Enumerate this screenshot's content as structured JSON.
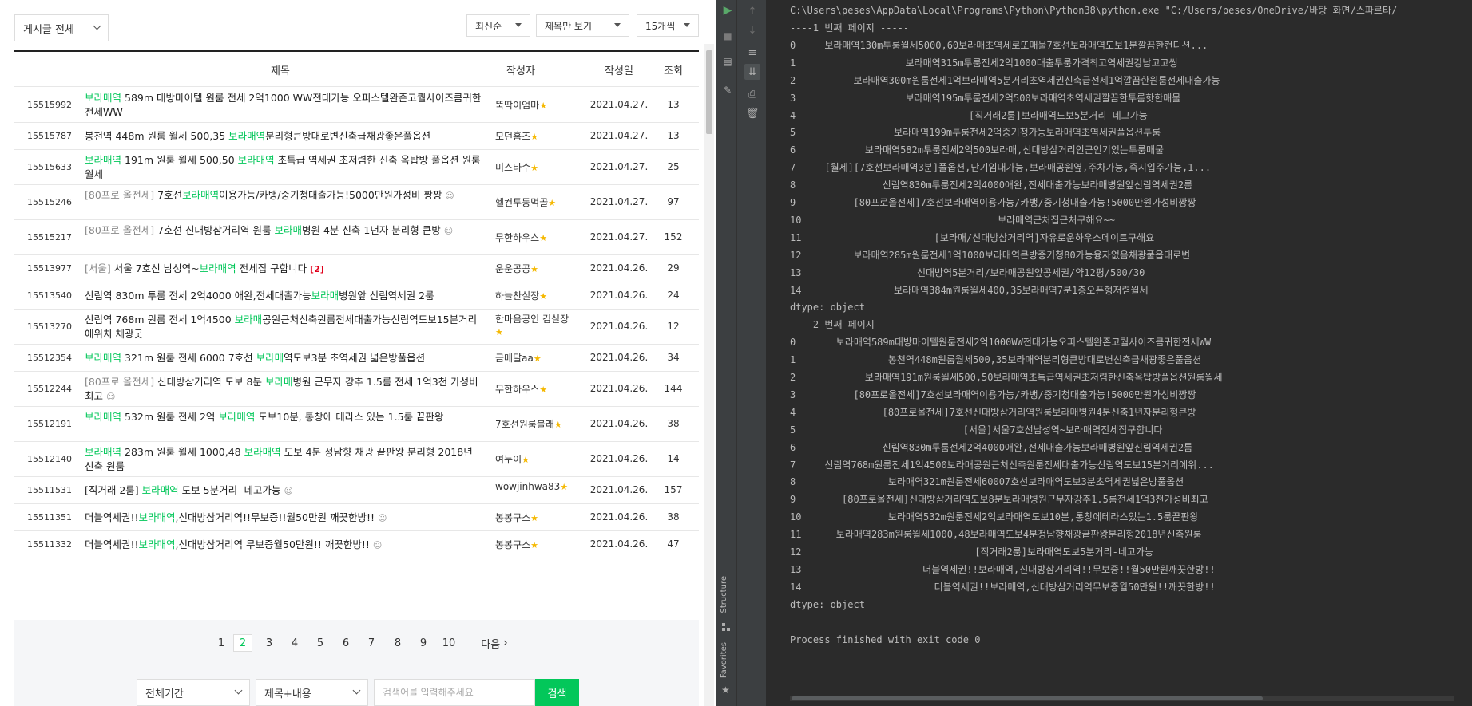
{
  "board": {
    "filters": {
      "category": "게시글 전체",
      "sort": "최신순",
      "view": "제목만 보기",
      "per_page": "15개씩"
    },
    "headers": {
      "title": "제목",
      "author": "작성자",
      "date": "작성일",
      "views": "조회"
    },
    "rows": [
      {
        "no": "15515992",
        "title": [
          {
            "t": "보라매역",
            "c": "hl"
          },
          {
            "t": " 589m 대방마이텔 원룸 전세 2억1000 WW전대가능 오피스텔완존고퀄사이즈큼귀한전세WW",
            "c": ""
          }
        ],
        "author": "뚝딱이엄마",
        "star": true,
        "date": "2021.04.27.",
        "views": "13"
      },
      {
        "no": "15515787",
        "title": [
          {
            "t": "봉천역 448m 원룸 월세 500,35 ",
            "c": ""
          },
          {
            "t": "보라매역",
            "c": "hl"
          },
          {
            "t": "분리형큰방대로변신축급채광좋은풀옵션",
            "c": ""
          }
        ],
        "author": "모던홈즈",
        "star": true,
        "date": "2021.04.27.",
        "views": "13"
      },
      {
        "no": "15515633",
        "title": [
          {
            "t": "보라매역",
            "c": "hl"
          },
          {
            "t": " 191m 원룸 월세 500,50 ",
            "c": ""
          },
          {
            "t": "보라매역",
            "c": "hl"
          },
          {
            "t": " 초특급 역세권 초저렴한 신축 옥탑방 풀옵션 원룸 월세",
            "c": ""
          }
        ],
        "author": "미스타수",
        "star": true,
        "date": "2021.04.27.",
        "views": "25"
      },
      {
        "no": "15515246",
        "title": [
          {
            "t": "[80프로 올전세] ",
            "c": "pre"
          },
          {
            "t": "7호선",
            "c": ""
          },
          {
            "t": "보라매역",
            "c": "hl"
          },
          {
            "t": "이용가능/카뱅/중기청대출가능!5000만원가성비 짱짱 ",
            "c": ""
          },
          {
            "t": "☺",
            "c": "emo"
          }
        ],
        "author": "헬컨투동먹골",
        "star": true,
        "date": "2021.04.27.",
        "views": "97"
      },
      {
        "no": "15515217",
        "title": [
          {
            "t": "[80프로 올전세] ",
            "c": "pre"
          },
          {
            "t": "7호선 신대방삼거리역 원룸 ",
            "c": ""
          },
          {
            "t": "보라매",
            "c": "hl"
          },
          {
            "t": "병원 4분 신축 1년자 분리형 큰방 ",
            "c": ""
          },
          {
            "t": "☺",
            "c": "emo"
          }
        ],
        "author": "무한하우스",
        "star": true,
        "date": "2021.04.27.",
        "views": "152"
      },
      {
        "no": "15513977",
        "title": [
          {
            "t": "[서울] ",
            "c": "pre"
          },
          {
            "t": "서울 7호선 남성역~",
            "c": ""
          },
          {
            "t": "보라매역",
            "c": "hl"
          },
          {
            "t": " 전세집 구합니다 ",
            "c": ""
          },
          {
            "t": "[2]",
            "c": "cnt"
          }
        ],
        "author": "운운공공",
        "star": true,
        "date": "2021.04.26.",
        "views": "29"
      },
      {
        "no": "15513540",
        "title": [
          {
            "t": "신림역 830m 투룸 전세 2억4000 애완,전세대출가능",
            "c": ""
          },
          {
            "t": "보라매",
            "c": "hl"
          },
          {
            "t": "병원앞 신림역세권 2룸",
            "c": ""
          }
        ],
        "author": "하늘찬실장",
        "star": true,
        "date": "2021.04.26.",
        "views": "24"
      },
      {
        "no": "15513270",
        "title": [
          {
            "t": "신림역 768m 원룸 전세 1억4500 ",
            "c": ""
          },
          {
            "t": "보라매",
            "c": "hl"
          },
          {
            "t": "공원근처신축원룸전세대출가능신림역도보15분거리에위치 채광굿",
            "c": ""
          }
        ],
        "author": "한마음공인 김실장",
        "star": true,
        "date": "2021.04.26.",
        "views": "12"
      },
      {
        "no": "15512354",
        "title": [
          {
            "t": "보라매역",
            "c": "hl"
          },
          {
            "t": " 321m 원룸 전세 6000 7호선 ",
            "c": ""
          },
          {
            "t": "보라매",
            "c": "hl"
          },
          {
            "t": "역도보3분 초역세권 넓은방풀옵션",
            "c": ""
          }
        ],
        "author": "금메달aa",
        "star": true,
        "date": "2021.04.26.",
        "views": "34"
      },
      {
        "no": "15512244",
        "title": [
          {
            "t": "[80프로 올전세] ",
            "c": "pre"
          },
          {
            "t": "신대방삼거리역 도보 8분 ",
            "c": ""
          },
          {
            "t": "보라매",
            "c": "hl"
          },
          {
            "t": "병원 근무자 강추 1.5룸 전세 1억3천 가성비 최고 ",
            "c": ""
          },
          {
            "t": "☺",
            "c": "emo"
          }
        ],
        "author": "무한하우스",
        "star": true,
        "date": "2021.04.26.",
        "views": "144"
      },
      {
        "no": "15512191",
        "title": [
          {
            "t": "보라매역",
            "c": "hl"
          },
          {
            "t": " 532m 원룸 전세 2억 ",
            "c": ""
          },
          {
            "t": "보라매역",
            "c": "hl"
          },
          {
            "t": " 도보10분, 통창에 테라스 있는 1.5룸 끝판왕",
            "c": ""
          }
        ],
        "author": "7호선원룸블래",
        "star": true,
        "date": "2021.04.26.",
        "views": "38"
      },
      {
        "no": "15512140",
        "title": [
          {
            "t": "보라매역",
            "c": "hl"
          },
          {
            "t": " 283m 원룸 월세 1000,48 ",
            "c": ""
          },
          {
            "t": "보라매역",
            "c": "hl"
          },
          {
            "t": " 도보 4분 정남향 채광 끝판왕 분리형 2018년 신축 원룸",
            "c": ""
          }
        ],
        "author": "여누이",
        "star": true,
        "date": "2021.04.26.",
        "views": "14"
      },
      {
        "no": "15511531",
        "title": [
          {
            "t": "[직거래 2룸] ",
            "c": ""
          },
          {
            "t": "보라매역",
            "c": "hl"
          },
          {
            "t": " 도보 5분거리- 네고가능 ",
            "c": ""
          },
          {
            "t": "☺",
            "c": "emo"
          }
        ],
        "author": "wowjinhwa83",
        "star": true,
        "date": "2021.04.26.",
        "views": "157"
      },
      {
        "no": "15511351",
        "title": [
          {
            "t": "더블역세권!!",
            "c": ""
          },
          {
            "t": "보라매역",
            "c": "hl"
          },
          {
            "t": ",신대방삼거리역!!무보증!!월50만원 깨끗한방!! ",
            "c": ""
          },
          {
            "t": "☺",
            "c": "emo"
          }
        ],
        "author": "봉봉구스",
        "star": true,
        "date": "2021.04.26.",
        "views": "38"
      },
      {
        "no": "15511332",
        "title": [
          {
            "t": "더블역세권!!",
            "c": ""
          },
          {
            "t": "보라매역",
            "c": "hl"
          },
          {
            "t": ",신대방삼거리역 무보증월50만원!! 깨끗한방!! ",
            "c": ""
          },
          {
            "t": "☺",
            "c": "emo"
          }
        ],
        "author": "봉봉구스",
        "star": true,
        "date": "2021.04.26.",
        "views": "47"
      }
    ],
    "pagination": {
      "pages": [
        "1",
        "2",
        "3",
        "4",
        "5",
        "6",
        "7",
        "8",
        "9",
        "10"
      ],
      "current": "2",
      "next": "다음"
    },
    "search": {
      "period": "전체기간",
      "scope": "제목+내용",
      "placeholder": "검색어를 입력해주세요",
      "button": "검색"
    }
  },
  "console": {
    "cmd": "C:\\Users\\peses\\AppData\\Local\\Programs\\Python\\Python38\\python.exe \"C:/Users/peses/OneDrive/바탕 화면/스파르타/",
    "lines": [
      "----1 번째 페이지 -----",
      "0     보라매역130m투룸월세5000,60보라매초역세로또매물7호선보라매역도보1분깔끔한컨디션...",
      "1                   보라매역315m투룸전세2억1000대출투룸가격최고역세권강남고고씽",
      "2          보라매역300m원룸전세1억보라매역5분거리초역세권신축급전세1억깔끔한원룸전세대출가능",
      "3                   보라매역195m투룸전세2억500보라매역초역세권깔끔한투룸핫한매물",
      "4                              [직거래2룸]보라매역도보5분거리-네고가능",
      "5                 보라매역199m투룸전세2억중기청가능보라매역초역세권풀옵션투룸",
      "6            보라매역582m투룸전세2억500보라매,신대방삼거리인근인기있는투룸매물",
      "7     [월세][7호선보라매역3분]풀옵션,단기임대가능,보라매공원옆,주차가능,즉시입주가능,1...",
      "8               신림역830m투룸전세2억4000애완,전세대출가능보라매병원앞신림역세권2룸",
      "9          [80프로올전세]7호선보라매역이용가능/카뱅/중기청대출가능!5000만원가성비짱짱",
      "10                                  보라매역근처집근처구해요~~",
      "11                       [보라매/신대방삼거리역]자유로운하우스메이트구해요",
      "12         보라매역285m원룸전세1억1000보라매역큰방중기청80가능융자없음채광풀옵대로변",
      "13                    신대방역5분거리/보라매공원앞공세권/약12평/500/30",
      "14                보라매역384m원룸월세400,35보라매역7분1층오픈형저렴월세",
      "dtype: object",
      "----2 번째 페이지 -----",
      "0       보라매역589m대방마이텔원룸전세2억1000WW전대가능오피스텔완존고퀄사이즈큼귀한전세WW",
      "1                봉천역448m원룸월세500,35보라매역분리형큰방대로변신축급채광좋은풀옵션",
      "2            보라매역191m원룸월세500,50보라매역초특급역세권초저렴한신축옥탑방풀옵션원룸월세",
      "3          [80프로올전세]7호선보라매역이용가능/카뱅/중기청대출가능!5000만원가성비짱짱",
      "4               [80프로올전세]7호선신대방삼거리역원룸보라매병원4분신축1년자분리형큰방",
      "5                             [서울]서울7호선남성역~보라매역전세집구합니다",
      "6               신림역830m투룸전세2억4000애완,전세대출가능보라매병원앞신림역세권2룸",
      "7     신림역768m원룸전세1억4500보라매공원근처신축원룸전세대출가능신림역도보15분거리에위...",
      "8                보라매역321m원룸전세60007호선보라매역도보3분초역세권넓은방풀옵션",
      "9        [80프로올전세]신대방삼거리역도보8분보라매병원근무자강추1.5룸전세1억3천가성비최고",
      "10               보라매역532m원룸전세2억보라매역도보10분,통창에테라스있는1.5룸끝판왕",
      "11      보라매역283m원룸월세1000,48보라매역도보4분정남향채광끝판왕분리형2018년신축원룸",
      "12                              [직거래2룸]보라매역도보5분거리-네고가능",
      "13                     더블역세권!!보라매역,신대방삼거리역!!무보증!!월50만원깨끗한방!!",
      "14                       더블역세권!!보라매역,신대방삼거리역무보증월50만원!!깨끗한방!!",
      "dtype: object",
      "",
      "Process finished with exit code 0"
    ],
    "side_labels": {
      "structure": "Structure",
      "favorites": "Favorites"
    }
  }
}
